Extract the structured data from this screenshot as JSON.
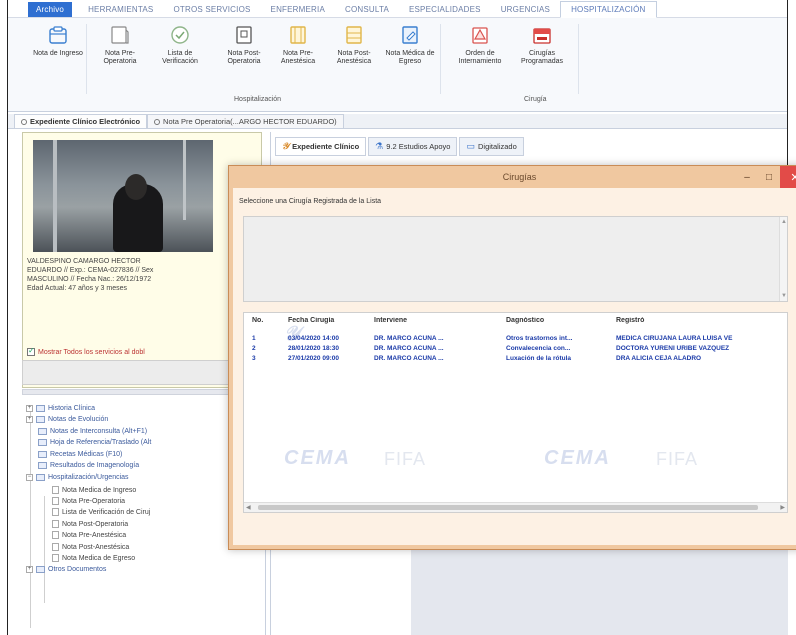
{
  "menu": {
    "tabs": [
      "Archivo",
      "HERRAMIENTAS",
      "OTROS SERVICIOS",
      "ENFERMERIA",
      "CONSULTA",
      "ESPECIALIDADES",
      "URGENCIAS",
      "HOSPITALIZACIÓN"
    ],
    "active": "HOSPITALIZACIÓN"
  },
  "ribbon": {
    "buttons": [
      {
        "label": "Nota de Ingreso",
        "icon": "clipboard-icon"
      },
      {
        "label": "Nota Pre-Operatoria",
        "icon": "notebook-icon"
      },
      {
        "label": "Lista de Verificación",
        "icon": "check-circle-icon"
      },
      {
        "label": "Nota Post-Operatoria",
        "icon": "document-icon"
      },
      {
        "label": "Nota Pre-Anestésica",
        "icon": "notebook-yellow-icon"
      },
      {
        "label": "Nota Post-Anestésica",
        "icon": "notebook-yellow-icon"
      },
      {
        "label": "Nota Médica de Egreso",
        "icon": "edit-document-icon"
      },
      {
        "label": "Orden de Internamiento",
        "icon": "warning-document-icon"
      },
      {
        "label": "Cirugías Programadas",
        "icon": "calendar-icon"
      }
    ],
    "groups": {
      "hospitalizacion": "Hospitalización",
      "cirugia": "Cirugía"
    }
  },
  "doc_tabs": [
    "Expediente Clínico Electrónico",
    "Nota Pre Operatoria(...ARGO HECTOR EDUARDO)"
  ],
  "patient": {
    "lines": [
      "VALDESPINO CAMARGO HECTOR",
      "EDUARDO // Exp.: CEMA-027836 // Sex",
      "MASCULINO // Fecha Nac.: 26/12/1972",
      "Edad Actual: 47 años y 3 meses"
    ],
    "show_all_label": "Mostrar Todos los servicios al dobl"
  },
  "tree": {
    "items": [
      {
        "label": "Historia Clínica",
        "level": 0
      },
      {
        "label": "Notas de Evolución",
        "level": 0
      },
      {
        "label": "Notas de Interconsulta (Alt+F1)",
        "level": 0
      },
      {
        "label": "Hoja de Referencia/Traslado (Alt",
        "level": 0
      },
      {
        "label": "Recetas Médicas (F10)",
        "level": 0
      },
      {
        "label": "Resultados de Imagenología",
        "level": 0
      },
      {
        "label": "Hospitalización/Urgencias",
        "level": 0
      },
      {
        "label": "Nota Medica de Ingreso",
        "level": 1
      },
      {
        "label": "Nota Pre-Operatoria",
        "level": 1
      },
      {
        "label": "Lista de Verificación de Ciruj",
        "level": 1
      },
      {
        "label": "Nota Post-Operatoria",
        "level": 1
      },
      {
        "label": "Nota Pre-Anestésica",
        "level": 1
      },
      {
        "label": "Nota Post-Anestésica",
        "level": 1
      },
      {
        "label": "Nota Medica de Egreso",
        "level": 1
      },
      {
        "label": "Otros Documentos",
        "level": 0
      }
    ]
  },
  "inner_tabs": [
    "Expediente Clínico",
    "9.2 Estudios Apoyo",
    "Digitalizado"
  ],
  "dialog": {
    "title": "Cirugías",
    "prompt": "Seleccione una Cirugía Registrada de la Lista",
    "columns": [
      "No.",
      "Fecha Cirugía",
      "Interviene",
      "Dagnóstico",
      "Registró"
    ],
    "rows": [
      [
        "1",
        "03/04/2020 14:00",
        "DR. MARCO ACUÑA ...",
        "Otros trastornos int...",
        "MEDICA CIRUJANA LAURA LUISA VE"
      ],
      [
        "2",
        "28/01/2020 18:30",
        "DR. MARCO ACUÑA ...",
        "Convalecencia con...",
        "DOCTORA YURENI URIBE VAZQUEZ"
      ],
      [
        "3",
        "27/01/2020 09:00",
        "DR. MARCO ACUÑA ...",
        "Luxación de la rótula",
        "DRA ALICIA CEJA ALADRO"
      ]
    ],
    "watermarks": [
      "CEMA",
      "FIFA",
      "CEMA",
      "FIFA"
    ]
  },
  "colors": {
    "archivo_tab": "#2f6fd1",
    "dialog_frame": "#f0c8a0",
    "close_button": "#e24b48",
    "row_text": "#1a3aa8"
  }
}
